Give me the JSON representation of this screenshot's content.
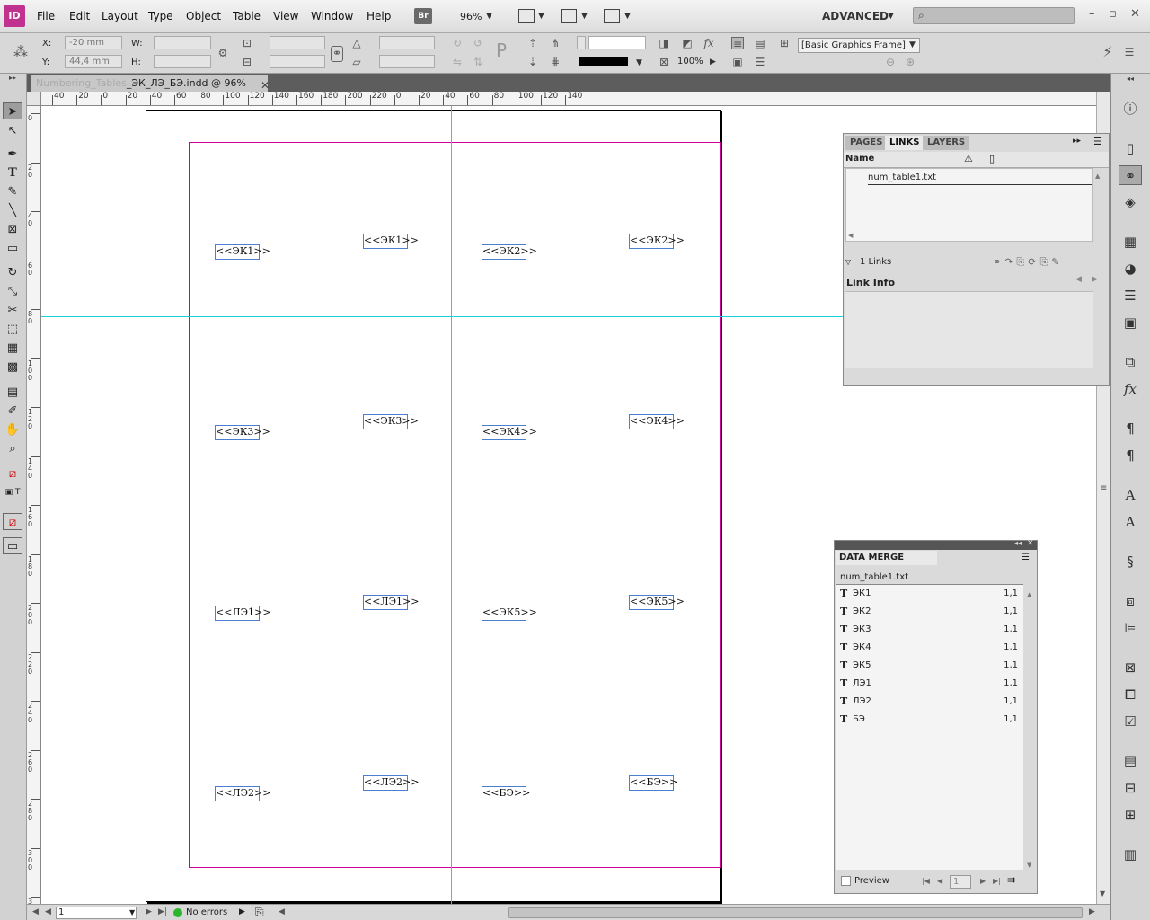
{
  "app": {
    "logo": "ID",
    "menus": [
      "File",
      "Edit",
      "Layout",
      "Type",
      "Object",
      "Table",
      "View",
      "Window",
      "Help"
    ],
    "bridge": "Br",
    "zoom": "96%",
    "workspace": "ADVANCED"
  },
  "control": {
    "x_label": "X:",
    "x_value": "-20 mm",
    "y_label": "Y:",
    "y_value": "44,4 mm",
    "w_label": "W:",
    "h_label": "H:",
    "opacity": "100%",
    "frame_style": "[Basic Graphics Frame]"
  },
  "document": {
    "tab_blurred": "Numbering_Tables",
    "tab_title": "_ЭК_ЛЭ_БЭ.indd @ 96%"
  },
  "ruler_h": [
    "40",
    "20",
    "0",
    "20",
    "40",
    "60",
    "80",
    "100",
    "120",
    "140",
    "160",
    "180",
    "200",
    "220",
    "0",
    "20",
    "40",
    "60",
    "80",
    "100",
    "120",
    "140"
  ],
  "ruler_v": [
    "0",
    "20",
    "40",
    "60",
    "80",
    "100",
    "120",
    "140",
    "160",
    "180",
    "200",
    "220",
    "240",
    "260",
    "280",
    "300",
    "3"
  ],
  "frames": [
    [
      "<<ЭК1>>",
      "<<ЭК1>>",
      "<<ЭК2>>",
      "<<ЭК2>>"
    ],
    [
      "<<ЭК3>>",
      "<<ЭК3>>",
      "<<ЭК4>>",
      "<<ЭК4>>"
    ],
    [
      "<<ЛЭ1>>",
      "<<ЛЭ1>>",
      "<<ЭК5>>",
      "<<ЭК5>>"
    ],
    [
      "<<ЛЭ2>>",
      "<<ЛЭ2>>",
      "<<БЭ>>",
      "<<БЭ>>"
    ]
  ],
  "links_panel": {
    "tabs": [
      "PAGES",
      "LINKS",
      "LAYERS"
    ],
    "column_name": "Name",
    "items": [
      "num_table1.txt"
    ],
    "count": "1 Links",
    "link_info": "Link Info"
  },
  "data_merge": {
    "title": "DATA MERGE",
    "source": "num_table1.txt",
    "fields": [
      {
        "name": "ЭК1",
        "value": "1,1"
      },
      {
        "name": "ЭК2",
        "value": "1,1"
      },
      {
        "name": "ЭК3",
        "value": "1,1"
      },
      {
        "name": "ЭК4",
        "value": "1,1"
      },
      {
        "name": "ЭК5",
        "value": "1,1"
      },
      {
        "name": "ЛЭ1",
        "value": "1,1"
      },
      {
        "name": "ЛЭ2",
        "value": "1,1"
      },
      {
        "name": "БЭ",
        "value": "1,1"
      }
    ],
    "field_type_glyph": "T",
    "preview": "Preview",
    "record": "1"
  },
  "status": {
    "page": "1",
    "errors": "No errors"
  },
  "colors": {
    "margin": "#d000a0",
    "guide": "#1ad1e0",
    "frame": "#4a7fd0",
    "status_ok": "#2db52d"
  }
}
